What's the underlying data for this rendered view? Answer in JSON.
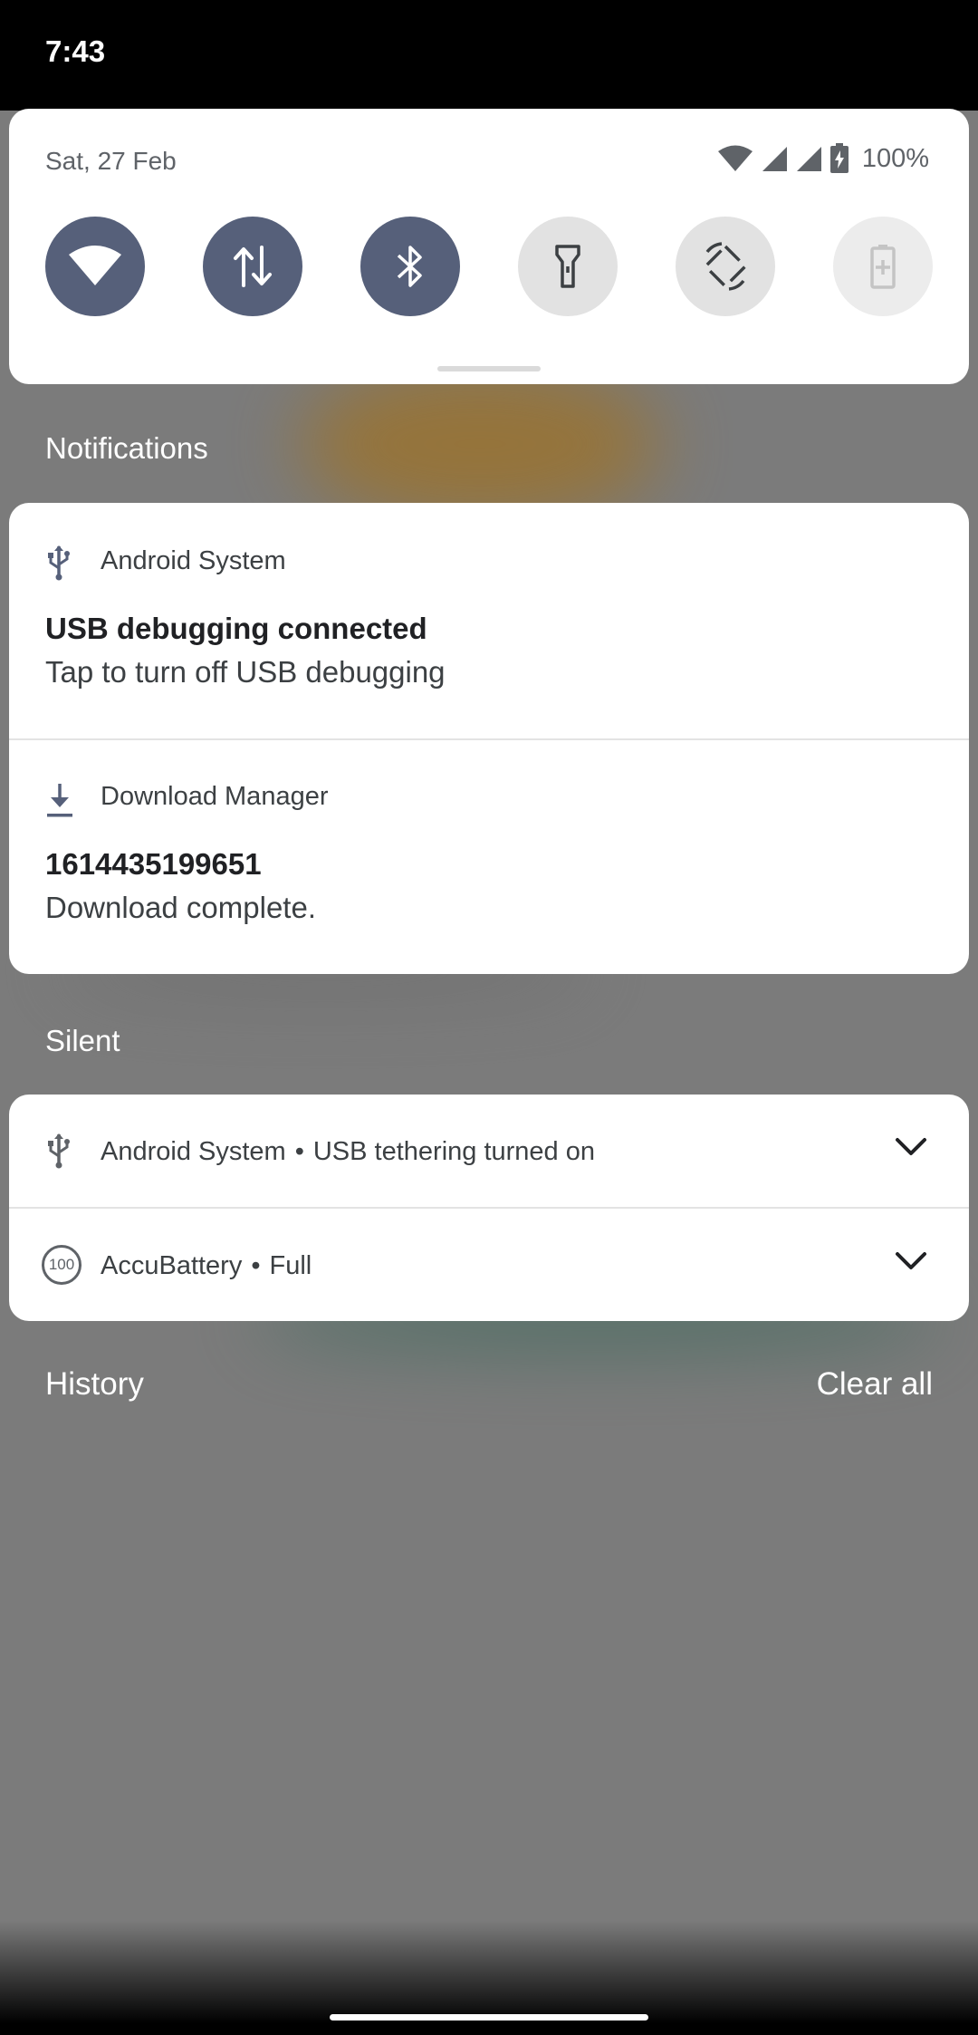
{
  "status_bar": {
    "time": "7:43"
  },
  "quick_settings": {
    "date": "Sat, 27 Feb",
    "battery_percent": "100%",
    "tiles": [
      {
        "name": "wifi",
        "state": "on"
      },
      {
        "name": "mobile-data",
        "state": "on"
      },
      {
        "name": "bluetooth",
        "state": "on"
      },
      {
        "name": "flashlight",
        "state": "off"
      },
      {
        "name": "auto-rotate",
        "state": "off"
      },
      {
        "name": "battery-saver",
        "state": "disabled"
      }
    ]
  },
  "sections": {
    "notifications": "Notifications",
    "silent": "Silent",
    "history": "History",
    "clear_all": "Clear all"
  },
  "notifications": [
    {
      "app": "Android System",
      "icon": "usb-icon",
      "title": "USB debugging connected",
      "text": "Tap to turn off USB debugging"
    },
    {
      "app": "Download Manager",
      "icon": "download-icon",
      "title": "1614435199651",
      "text": "Download complete."
    }
  ],
  "silent": [
    {
      "app": "Android System",
      "summary": "USB tethering turned on",
      "icon": "usb-icon"
    },
    {
      "app": "AccuBattery",
      "summary": "Full",
      "icon": "accubattery-icon",
      "icon_text": "100"
    }
  ],
  "colors": {
    "tile_on": "#56607a",
    "tile_off": "#e2e2e2",
    "scrim": "#7b7b7b"
  }
}
